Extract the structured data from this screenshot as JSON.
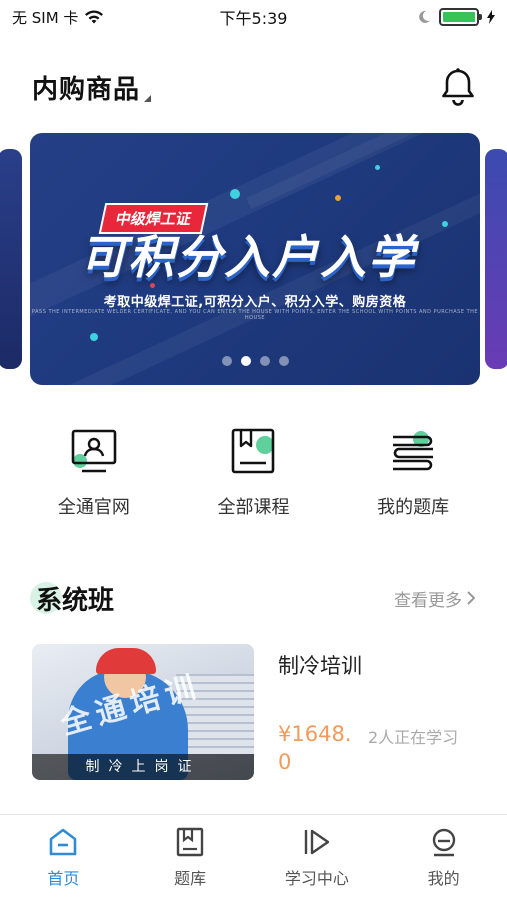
{
  "status_bar": {
    "carrier": "无 SIM 卡",
    "time": "下午5:39"
  },
  "header": {
    "title": "内购商品"
  },
  "banner": {
    "tag": "中级焊工证",
    "headline": "可积分入户入学",
    "subline": "考取中级焊工证,可积分入户、积分入学、购房资格",
    "finetext": "PASS THE INTERMEDIATE WELDER CERTIFICATE, AND YOU CAN ENTER THE HOUSE WITH POINTS, ENTER THE SCHOOL WITH POINTS AND PURCHASE THE HOUSE",
    "page_count": 4,
    "active_page": 2
  },
  "quick_entries": [
    {
      "label": "全通官网",
      "icon": "profile-card-icon"
    },
    {
      "label": "全部课程",
      "icon": "course-book-icon"
    },
    {
      "label": "我的题库",
      "icon": "book-stack-icon"
    }
  ],
  "section": {
    "title": "系统班",
    "more": "查看更多"
  },
  "course": {
    "title": "制冷培训",
    "thumb_watermark": "全通培训",
    "thumb_caption": "制冷上岗证",
    "price": "¥1648.0",
    "learners": "2人正在学习"
  },
  "tabbar": [
    {
      "label": "首页",
      "icon": "home-icon",
      "active": true
    },
    {
      "label": "题库",
      "icon": "bookmark-book-icon",
      "active": false
    },
    {
      "label": "学习中心",
      "icon": "play-icon",
      "active": false
    },
    {
      "label": "我的",
      "icon": "profile-face-icon",
      "active": false
    }
  ],
  "colors": {
    "accent": "#2f8bd6",
    "green_accent": "#5fcf9c",
    "price": "#f39a5a",
    "banner_bg": "#253f86",
    "tag_red": "#e8273a"
  }
}
